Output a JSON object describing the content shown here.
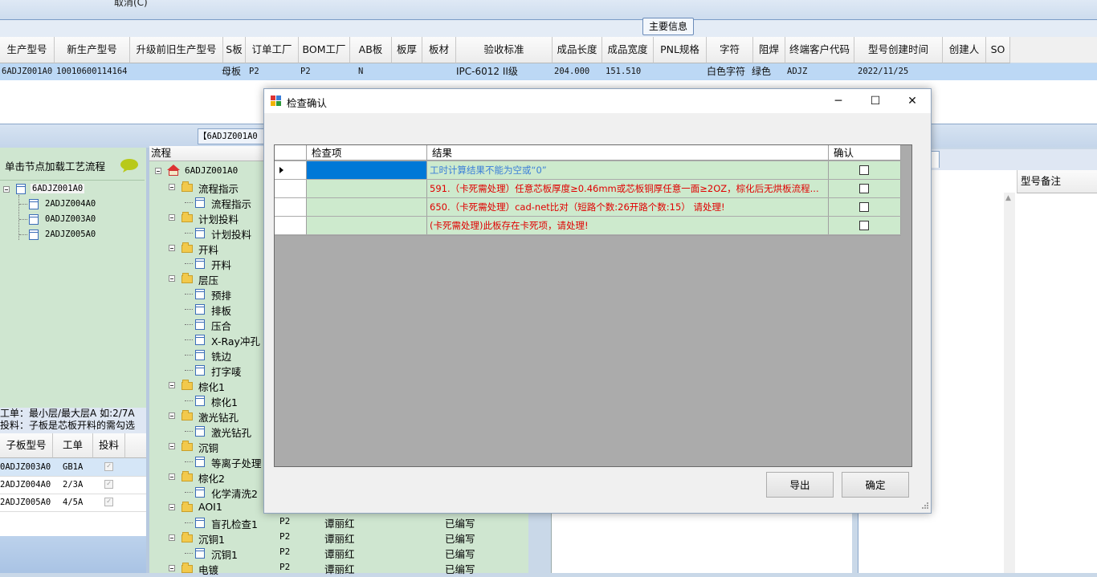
{
  "top": {
    "cancel_text": "取消(C)",
    "main_info_label": "主要信息"
  },
  "main_grid": {
    "headers": [
      "生产型号",
      "新生产型号",
      "升级前旧生产型号",
      "S板",
      "订单工厂",
      "BOM工厂",
      "AB板",
      "板厚",
      "板材",
      "验收标准",
      "成品长度",
      "成品宽度",
      "PNL规格",
      "字符",
      "阻焊",
      "终端客户代码",
      "型号创建时间",
      "创建人",
      "SO"
    ],
    "row": [
      "6ADJZ001A0",
      "10010600114164",
      "",
      "母板",
      "P2",
      "P2",
      "N",
      "",
      "",
      "IPC-6012 II级",
      "204.000",
      "151.510",
      "",
      "白色字符",
      "绿色",
      "ADJZ",
      "2022/11/25",
      "",
      ""
    ]
  },
  "mid_tab": "【6ADJZ001A0",
  "left_panel": {
    "title": "单击节点加载工艺流程",
    "tree_root": "6ADJZ001A0",
    "tree_children": [
      "2ADJZ004A0",
      "0ADJZ003A0",
      "2ADJZ005A0"
    ],
    "info_line1": "工单：最小层/最大层A 如:2/7A",
    "info_line2": "投料：子板是芯板开料的需勾选",
    "sub_headers": [
      "子板型号",
      "工单",
      "投料"
    ],
    "sub_rows": [
      {
        "model": "0ADJZ003A0",
        "order": "GB1A",
        "checked": true
      },
      {
        "model": "2ADJZ004A0",
        "order": "2/3A",
        "checked": true
      },
      {
        "model": "2ADJZ005A0",
        "order": "4/5A",
        "checked": true
      }
    ]
  },
  "flow": {
    "header": "流程",
    "root": "6ADJZ001A0",
    "nodes": [
      {
        "label": "流程指示",
        "level": 1
      },
      {
        "label": "流程指示",
        "level": 2
      },
      {
        "label": "计划投料",
        "level": 1
      },
      {
        "label": "计划投料",
        "level": 2
      },
      {
        "label": "开料",
        "level": 1
      },
      {
        "label": "开料",
        "level": 2
      },
      {
        "label": "层压",
        "level": 1
      },
      {
        "label": "预排",
        "level": 2
      },
      {
        "label": "排板",
        "level": 2
      },
      {
        "label": "压合",
        "level": 2
      },
      {
        "label": "X-Ray冲孔",
        "level": 2
      },
      {
        "label": "铣边",
        "level": 2
      },
      {
        "label": "打字唛",
        "level": 2
      },
      {
        "label": "棕化1",
        "level": 1
      },
      {
        "label": "棕化1",
        "level": 2
      },
      {
        "label": "激光钻孔",
        "level": 1
      },
      {
        "label": "激光钻孔",
        "level": 2
      },
      {
        "label": "沉铜",
        "level": 1
      },
      {
        "label": "等离子处理",
        "level": 2
      },
      {
        "label": "棕化2",
        "level": 1
      },
      {
        "label": "化学清洗2",
        "level": 2
      },
      {
        "label": "AOI1",
        "level": 1
      },
      {
        "label": "盲孔检查1",
        "level": 2
      },
      {
        "label": "沉铜1",
        "level": 1
      },
      {
        "label": "沉铜1",
        "level": 2
      },
      {
        "label": "电镀",
        "level": 1
      }
    ],
    "extra_rows": [
      {
        "factory": "P2",
        "person": "谭丽红",
        "status": "已编写"
      },
      {
        "factory": "P2",
        "person": "谭丽红",
        "status": "已编写"
      },
      {
        "factory": "P2",
        "person": "谭丽红",
        "status": "已编写"
      },
      {
        "factory": "P2",
        "person": "谭丽红",
        "status": "已编写"
      }
    ]
  },
  "right_panel": {
    "remark_header": "型号备注"
  },
  "dialog": {
    "title": "检查确认",
    "columns": [
      "检查项",
      "结果",
      "确认"
    ],
    "rows": [
      {
        "item": "",
        "result": "工时计算结果不能为空或“0”",
        "result_color": "#3a7ed8",
        "confirmed": false,
        "selected": true
      },
      {
        "item": "",
        "result": "591.（卡死需处理）任意芯板厚度≥0.46mm或芯板铜厚任意一面≥2OZ，棕化后无烘板流程...",
        "result_color": "#e00000",
        "confirmed": false,
        "selected": false
      },
      {
        "item": "",
        "result": "650.（卡死需处理）cad-net比对（短路个数:26开路个数:15） 请处理!",
        "result_color": "#e00000",
        "confirmed": false,
        "selected": false
      },
      {
        "item": "",
        "result": "(卡死需处理)此板存在卡死项，请处理!",
        "result_color": "#e00000",
        "confirmed": false,
        "selected": false
      }
    ],
    "buttons": {
      "export": "导出",
      "ok": "确定"
    },
    "window_controls": {
      "minimize": "─",
      "maximize": "☐",
      "close": "✕"
    }
  }
}
